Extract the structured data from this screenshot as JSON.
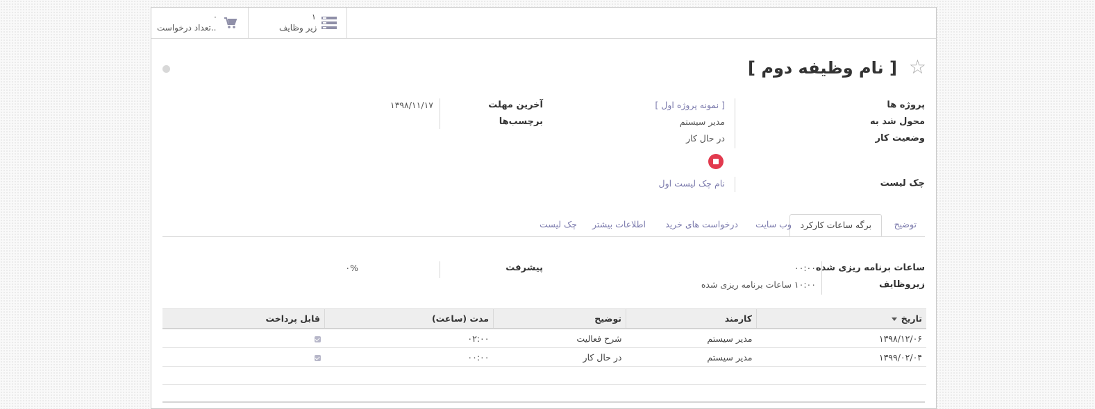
{
  "buttons": {
    "requests": {
      "count": "۰",
      "label": "تعداد درخواست.."
    },
    "subtasks": {
      "count": "۱",
      "label": "زیر وظایف"
    }
  },
  "task": {
    "title": "[ نام وظیفه دوم ]"
  },
  "fields": {
    "project_label": "پروژه ها",
    "project_value": "[ نمونه پروژه اول ]",
    "assigned_label": "محول شد به",
    "assigned_value": "مدیر سیستم",
    "state_label": "وضعیت کار",
    "state_value": "در حال کار",
    "deadline_label": "آخرین مهلت",
    "deadline_value": "۱۳۹۸/۱۱/۱۷",
    "tags_label": "برچسب‌ها",
    "checklist_label": "چک لیست",
    "checklist_value": "نام چک لیست اول"
  },
  "tabs": [
    {
      "label": "توضیح"
    },
    {
      "label": "برگه ساعات کارکرد"
    },
    {
      "label": "وب سایت"
    },
    {
      "label": "درخواست های خرید"
    },
    {
      "label": "اطلاعات بیشتر"
    },
    {
      "label": "چک لیست"
    }
  ],
  "timesheet": {
    "planned_label": "ساعات برنامه ریزی شده",
    "planned_value": "۰۰:۰۰",
    "subtask_label": "زیروظایف",
    "subtask_value": "۱۰:۰۰ ساعات برنامه ریزی شده",
    "progress_label": "پیشرفت",
    "progress_value": "۰%"
  },
  "table": {
    "headers": {
      "date": "تاریخ",
      "employee": "کارمند",
      "description": "توضیح",
      "duration": "مدت (ساعت)",
      "billable": "قابل پرداخت"
    },
    "rows": [
      {
        "date": "۱۳۹۸/۱۲/۰۶",
        "employee": "مدیر سیستم",
        "description": "شرح فعالیت",
        "duration": "۰۲:۰۰",
        "billable": true
      },
      {
        "date": "۱۳۹۹/۰۲/۰۴",
        "employee": "مدیر سیستم",
        "description": "در حال کار",
        "duration": "۰۰:۰۰",
        "billable": true
      }
    ]
  },
  "colors": {
    "accent": "#7c7bad",
    "stop": "#e23a4e"
  }
}
